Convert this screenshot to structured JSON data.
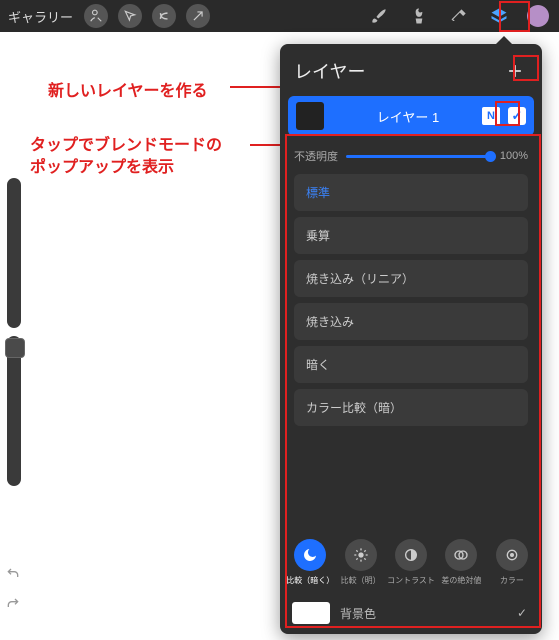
{
  "topbar": {
    "gallery_label": "ギャラリー",
    "tool_wrench": "🔧",
    "tool_share": "↗"
  },
  "annotations": {
    "new_layer": "新しいレイヤーを作る",
    "blend_popup_l1": "タップでブレンドモードの",
    "blend_popup_l2": "ポップアップを表示"
  },
  "panel": {
    "title": "レイヤー",
    "layer1": {
      "name": "レイヤー 1",
      "mode_chip": "N"
    },
    "opacity_label": "不透明度",
    "opacity_value": "100%",
    "blend_modes": [
      "標準",
      "乗算",
      "焼き込み（リニア）",
      "焼き込み",
      "暗く",
      "カラー比較（暗）"
    ],
    "categories": [
      {
        "label": "比較（暗く）"
      },
      {
        "label": "比較（明）"
      },
      {
        "label": "コントラスト"
      },
      {
        "label": "差の絶対値"
      },
      {
        "label": "カラー"
      }
    ],
    "background_label": "背景色"
  }
}
